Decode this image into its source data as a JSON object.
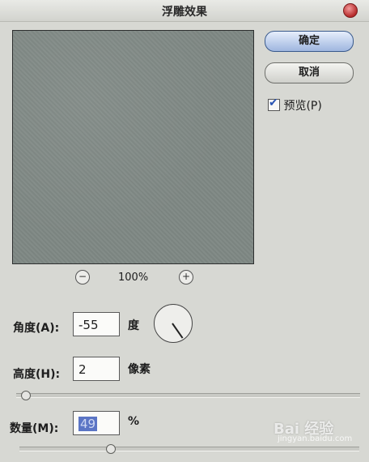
{
  "window": {
    "title": "浮雕效果"
  },
  "buttons": {
    "ok": "确定",
    "cancel": "取消"
  },
  "preview_checkbox": {
    "label": "预览(P)",
    "checked": true
  },
  "zoom": {
    "level": "100%",
    "minus": "⊖",
    "plus": "⊕"
  },
  "angle": {
    "label": "角度(A):",
    "value": "-55",
    "unit": "度"
  },
  "height": {
    "label": "高度(H):",
    "value": "2",
    "unit": "像素"
  },
  "amount": {
    "label": "数量(M):",
    "value": "49",
    "unit": "%"
  },
  "watermark": {
    "text": "Bai 经验",
    "sub": "jingyan.baidu.com"
  }
}
